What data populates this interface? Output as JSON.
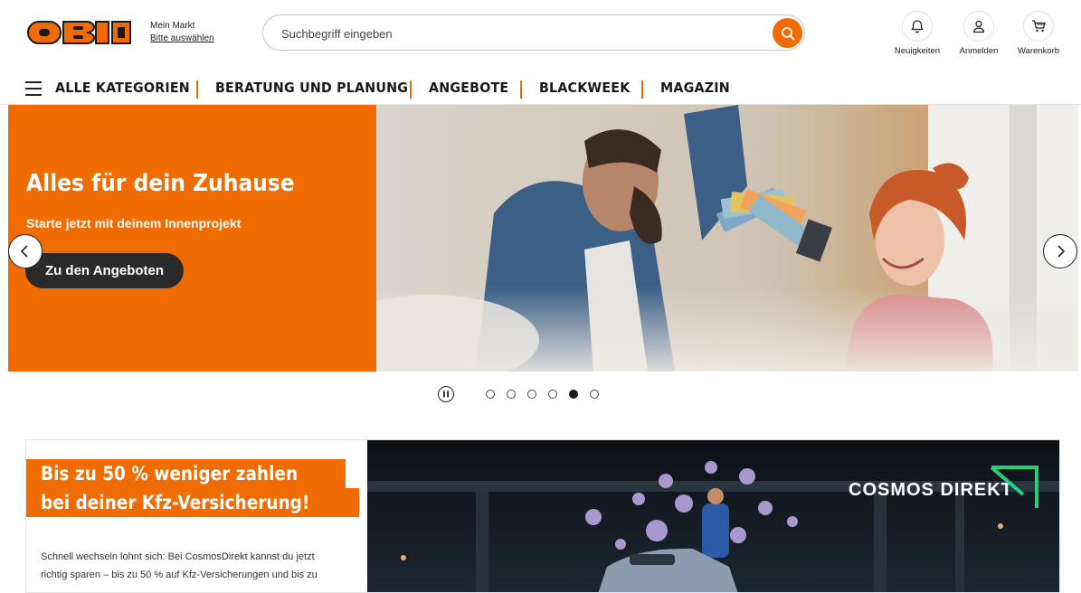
{
  "brand": {
    "logo_text": "OBI",
    "accent_color": "#f06c00"
  },
  "market": {
    "title": "Mein Markt",
    "link": "Bitte auswählen"
  },
  "search": {
    "placeholder": "Suchbegriff eingeben",
    "icon": "search-icon"
  },
  "utilities": [
    {
      "label": "Neuigkeiten",
      "icon": "bell-icon"
    },
    {
      "label": "Anmelden",
      "icon": "user-icon"
    },
    {
      "label": "Warenkorb",
      "icon": "cart-icon"
    }
  ],
  "nav": {
    "menu_icon": "hamburger-icon",
    "items": [
      "ALLE KATEGORIEN",
      "BERATUNG UND PLANUNG",
      "ANGEBOTE",
      "BLACKWEEK",
      "MAGAZIN"
    ]
  },
  "hero": {
    "title": "Alles für dein Zuhause",
    "subtitle": "Starte jetzt mit deinem Innenprojekt",
    "cta": "Zu den Angeboten",
    "slides_total": 6,
    "active_slide": 5
  },
  "promo": {
    "headline_1": "Bis zu 50 % weniger zahlen",
    "headline_2": "bei deiner Kfz-Versicherung!",
    "text": "Schnell wechseln lohnt sich: Bei CosmosDirekt kannst du jetzt richtig sparen – bis zu 50 % auf Kfz-Versicherungen und bis zu",
    "partner": "COSMOS DIREKT"
  }
}
